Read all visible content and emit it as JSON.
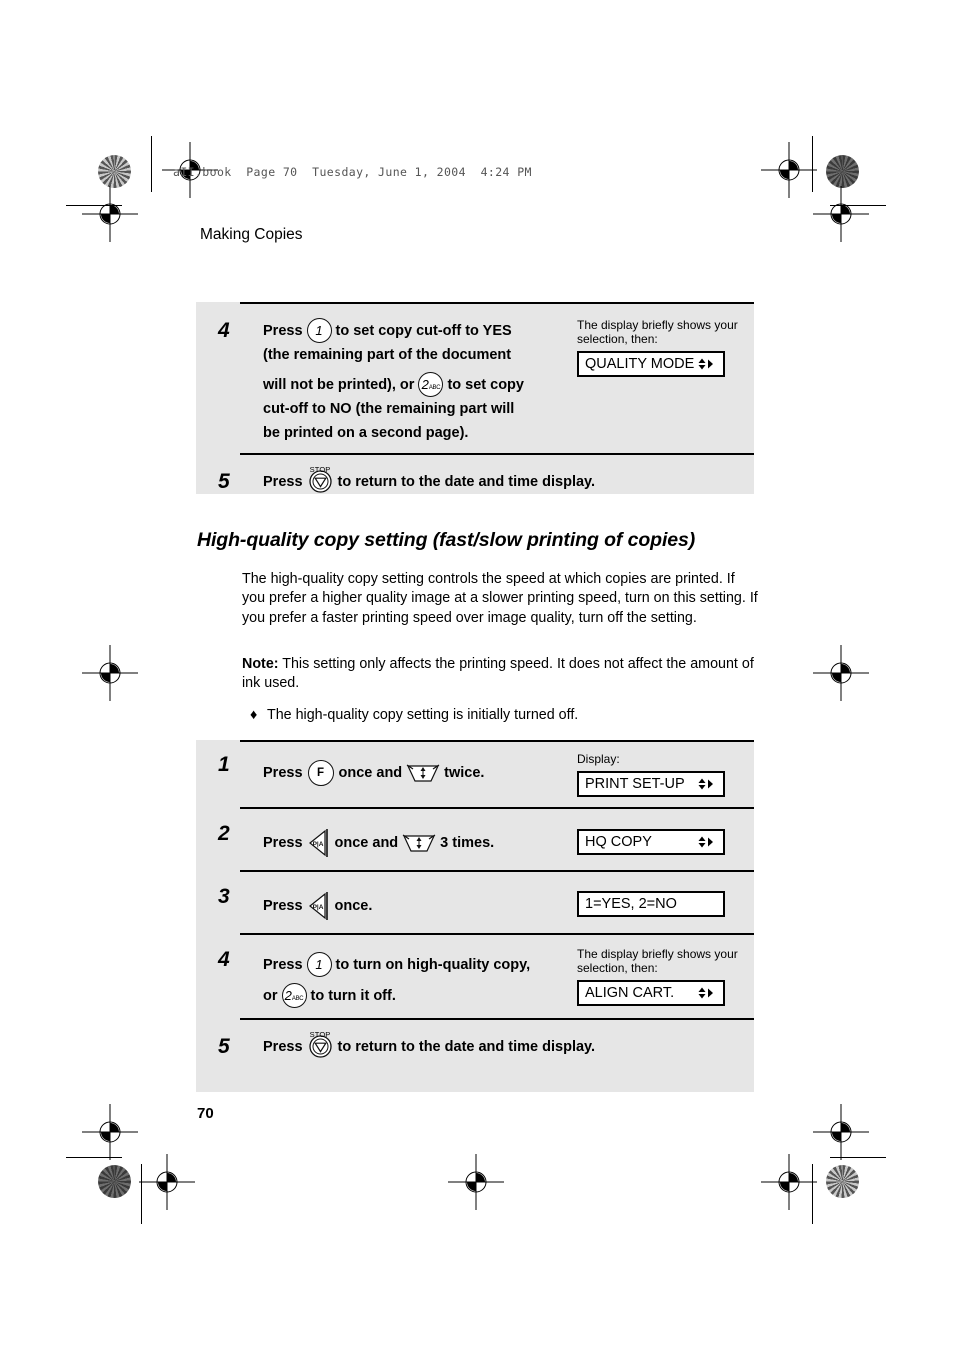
{
  "page": {
    "slug_line": "aII.book  Page 70  Tuesday, June 1, 2004  4:24 PM",
    "running_head": "Making Copies",
    "page_number": "70",
    "background_color": "#ffffff",
    "box_fill_color": "#e6e6e6"
  },
  "section": {
    "heading": "High-quality copy setting (fast/slow printing of copies)",
    "intro_paragraph": "The high-quality copy setting controls the speed at which copies are printed. If you prefer a higher quality image at a slower printing speed, turn on this setting. If you prefer a faster printing speed over image quality, turn off the setting.",
    "note_label": "Note:",
    "note_text": " This setting only affects the printing speed. It does not affect the amount of ink used.",
    "bullet_mark": "♦",
    "bullet_text": "The high-quality copy setting is initially turned off."
  },
  "procedure_top": {
    "steps": [
      {
        "number": "4",
        "text_a": "Press",
        "key_1_label": "1",
        "text_b": "to set copy cut-off to YES",
        "line2": "(the remaining part of the document",
        "line3_a": "will not be printed), or",
        "key_2_label": "2",
        "key_2_sub": "ABC",
        "line3_b": "to set copy",
        "line4": "cut-off to NO (the remaining part will",
        "line5": "be printed on a second page).",
        "side_caption": "The display briefly shows your selection, then:",
        "display_text": "QUALITY MODE"
      },
      {
        "number": "5",
        "text_a": "Press",
        "stop_label": "STOP",
        "text_b": "to return to the date and time display."
      }
    ]
  },
  "procedure_bottom": {
    "steps": [
      {
        "number": "1",
        "text_a": "Press",
        "key_f_label": "F",
        "text_b": "once and",
        "text_c": "twice.",
        "side_caption": "Display:",
        "display_text": "PRINT SET-UP"
      },
      {
        "number": "2",
        "text_a": "Press",
        "text_b": "once and",
        "text_c": "3 times.",
        "display_text": "HQ COPY"
      },
      {
        "number": "3",
        "text_a": "Press",
        "text_b": "once.",
        "display_text": "1=YES, 2=NO"
      },
      {
        "number": "4",
        "text_a": "Press",
        "key_1_label": "1",
        "text_b": "to turn on high-quality copy,",
        "line2_a": "or",
        "key_2_label": "2",
        "key_2_sub": "ABC",
        "line2_b": "to turn it off.",
        "side_caption": "The display briefly shows your selection, then:",
        "display_text": "ALIGN CART."
      },
      {
        "number": "5",
        "text_a": "Press",
        "stop_label": "STOP",
        "text_b": "to return to the date and time display."
      }
    ]
  }
}
